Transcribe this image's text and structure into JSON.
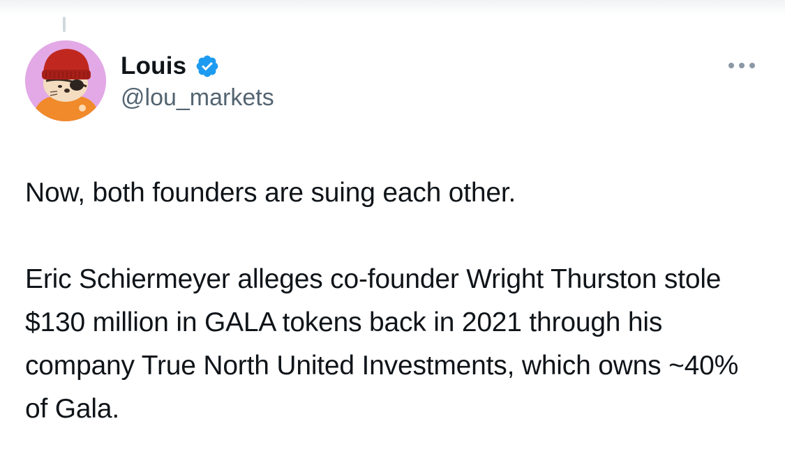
{
  "user": {
    "display_name": "Louis",
    "handle": "@lou_markets",
    "verified": true,
    "avatar_icon": "otter-in-red-beanie-avatar"
  },
  "tweet": {
    "paragraphs": [
      "Now, both founders are suing each other.",
      "Eric Schiermeyer alleges co-founder Wright Thurston stole $130 million in GALA tokens back in 2021 through his company True North United Investments, which owns ~40% of Gala."
    ]
  },
  "icons": {
    "verified": "verified-badge-icon",
    "more": "more-options-icon"
  },
  "colors": {
    "verified_blue": "#1d9bf0",
    "text": "#0f1419",
    "secondary_text": "#536471",
    "avatar_bg": "#e2a9e6"
  }
}
